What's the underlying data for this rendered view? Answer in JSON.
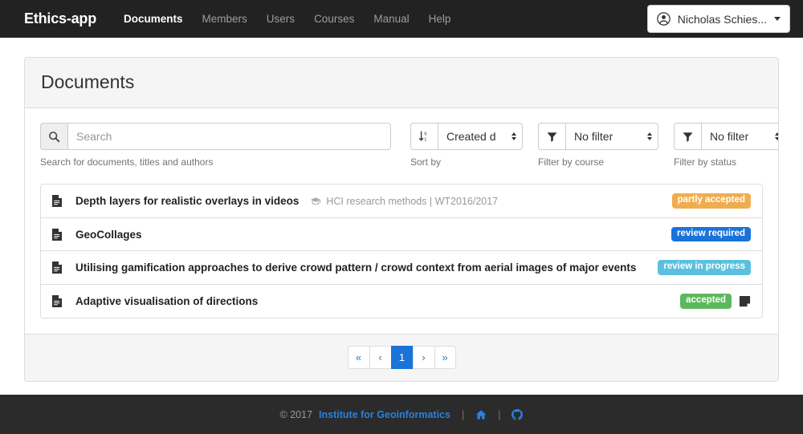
{
  "navbar": {
    "brand": "Ethics-app",
    "links": [
      {
        "label": "Documents",
        "active": true
      },
      {
        "label": "Members",
        "active": false
      },
      {
        "label": "Users",
        "active": false
      },
      {
        "label": "Courses",
        "active": false
      },
      {
        "label": "Manual",
        "active": false
      },
      {
        "label": "Help",
        "active": false
      }
    ],
    "user": {
      "name": "Nicholas Schies...",
      "icon": "user-circle-icon"
    }
  },
  "page": {
    "title": "Documents"
  },
  "toolbar": {
    "search": {
      "icon": "search-icon",
      "value": "",
      "placeholder": "Search",
      "help": "Search for documents, titles and authors"
    },
    "sort": {
      "icon": "sort-numeric-desc-icon",
      "value": "Created d",
      "help": "Sort by"
    },
    "course_filter": {
      "icon": "filter-icon",
      "value": "No filter",
      "help": "Filter by course"
    },
    "status_filter": {
      "icon": "filter-icon",
      "value": "No filter",
      "help": "Filter by status"
    }
  },
  "documents": [
    {
      "icon": "file-text-icon",
      "title": "Depth layers for realistic overlays in videos",
      "course": "HCI research methods | WT2016/2017",
      "course_icon": "graduation-cap-icon",
      "status": "partly accepted",
      "status_color": "#f0ad4e",
      "has_note": false
    },
    {
      "icon": "file-text-icon",
      "title": "GeoCollages",
      "course": "",
      "course_icon": "graduation-cap-icon",
      "status": "review required",
      "status_color": "#1a73d9",
      "has_note": false
    },
    {
      "icon": "file-text-icon",
      "title": "Utilising gamification approaches to derive crowd pattern / crowd context from aerial images of major events",
      "course": "",
      "course_icon": "graduation-cap-icon",
      "status": "review in progress",
      "status_color": "#5bc0de",
      "has_note": false
    },
    {
      "icon": "file-text-icon",
      "title": "Adaptive visualisation of directions",
      "course": "",
      "course_icon": "graduation-cap-icon",
      "status": "accepted",
      "status_color": "#5cb85c",
      "has_note": true,
      "note_icon": "sticky-note-icon"
    }
  ],
  "pagination": {
    "first": "«",
    "prev": "‹",
    "pages": [
      "1"
    ],
    "current": "1",
    "next": "›",
    "last": "»"
  },
  "footer": {
    "copyright": "© 2017",
    "org": "Institute for Geoinformatics",
    "separator": "|",
    "home_icon": "home-icon",
    "github_icon": "github-icon"
  }
}
